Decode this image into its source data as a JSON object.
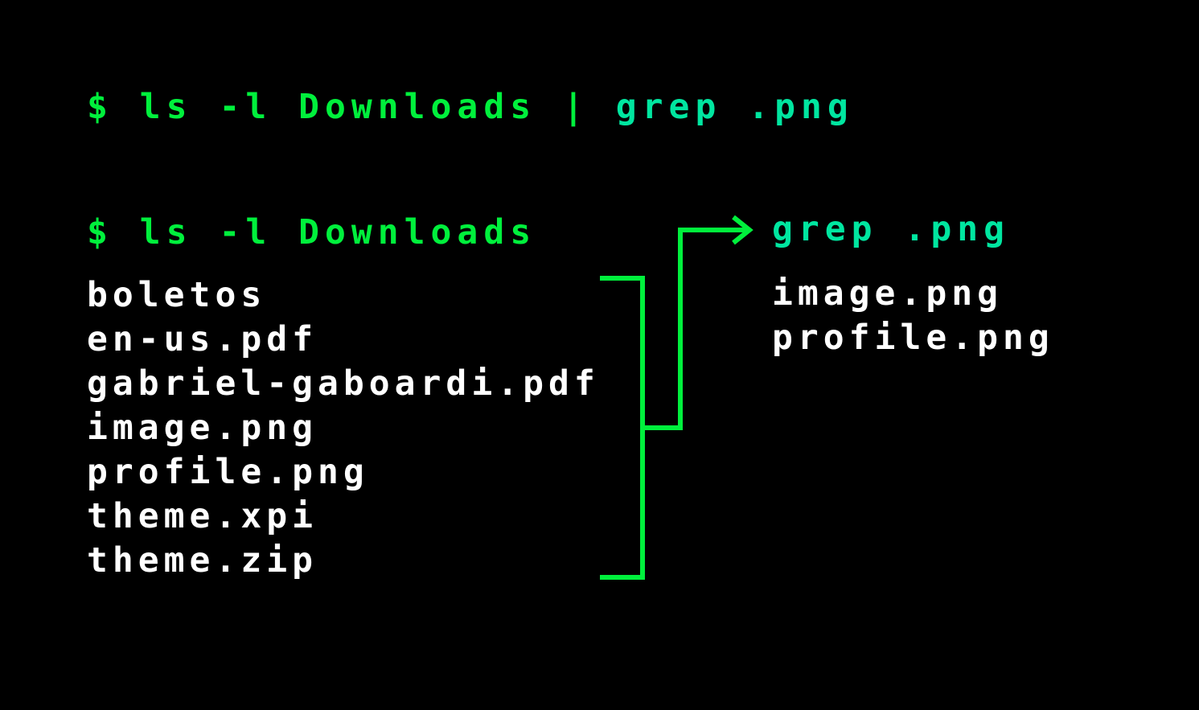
{
  "full_command": {
    "prompt": "$",
    "ls_part": " ls -l Downloads ",
    "pipe": "|",
    "grep_part": " grep .png"
  },
  "ls_command": "$ ls -l Downloads",
  "ls_output": [
    "boletos",
    "en-us.pdf",
    "gabriel-gaboardi.pdf",
    "image.png",
    "profile.png",
    "theme.xpi",
    "theme.zip"
  ],
  "grep_command": "grep .png",
  "grep_output": [
    "image.png",
    "profile.png"
  ],
  "colors": {
    "background": "#000000",
    "ls_green": "#00f03c",
    "grep_cyan": "#00e6a0",
    "output_white": "#ffffff"
  }
}
